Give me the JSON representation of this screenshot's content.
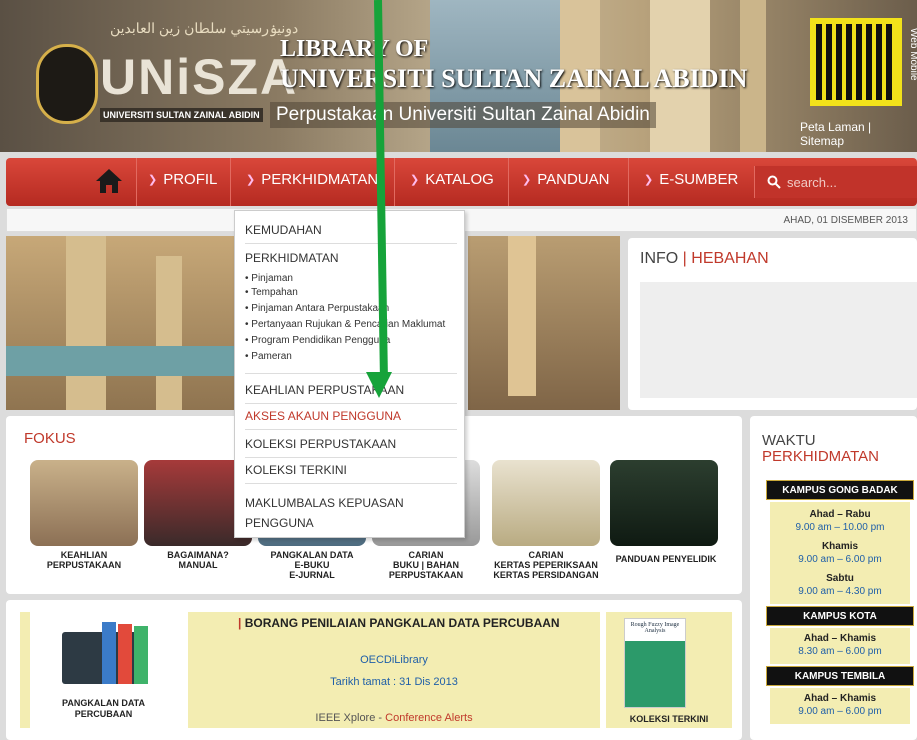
{
  "header": {
    "logo_text": "UNiSZA",
    "logo_arabic": "دونيۏرسيتي سلطان زين العابدين",
    "logo_sub": "UNIVERSITI SULTAN ZAINAL ABIDIN",
    "library_line1": "LIBRARY OF",
    "library_line2": "UNIVERSITI SULTAN ZAINAL ABIDIN",
    "library_line3": "Perpustakaan Universiti Sultan Zainal Abidin",
    "web_mobile": "Web Mobile",
    "peta_laman": "Peta Laman",
    "sitemap": "Sitemap"
  },
  "nav": {
    "items": [
      {
        "label": "PROFIL"
      },
      {
        "label": "PERKHIDMATAN"
      },
      {
        "label": "KATALOG"
      },
      {
        "label": "PANDUAN"
      },
      {
        "label": "E-SUMBER"
      }
    ],
    "search_placeholder": "search..."
  },
  "date": "AHAD, 01 DISEMBER 2013",
  "dropdown": {
    "kemudahan": "KEMUDAHAN",
    "perkhidmatan": "PERKHIDMATAN",
    "sub": [
      "Pinjaman",
      "Tempahan",
      "Pinjaman Antara Perpustakaan",
      "Pertanyaan Rujukan & Pencarian Maklumat",
      "Program Pendidikan Pengguna",
      "Pameran"
    ],
    "keahlian": "KEAHLIAN PERPUSTAKAAN",
    "akses": "AKSES AKAUN PENGGUNA",
    "koleksi_perpustakaan": "KOLEKSI PERPUSTAKAAN",
    "koleksi_terkini": "KOLEKSI TERKINI",
    "maklumbalas_1": "MAKLUMBALAS KEPUASAN",
    "maklumbalas_2": "PENGGUNA"
  },
  "info": {
    "title_a": "INFO",
    "sep": "|",
    "title_b": "HEBAHAN"
  },
  "fokus": {
    "title": "FOKUS",
    "items": [
      {
        "label": "KEAHLIAN\nPERPUSTAKAAN"
      },
      {
        "label": "BAGAIMANA?\nMANUAL"
      },
      {
        "label": "PANGKALAN DATA\nE-BUKU\nE-JURNAL"
      },
      {
        "label": "CARIAN\nBUKU | BAHAN\nPERPUSTAKAAN"
      },
      {
        "label": "CARIAN\nKERTAS PEPERIKSAAN\nKERTAS PERSIDANGAN"
      },
      {
        "label": "PANDUAN PENYELIDIK"
      }
    ]
  },
  "waktu": {
    "title_1": "WAKTU",
    "title_2": "PERKHIDMATAN",
    "kampus_gong_badak": "KAMPUS GONG BADAK",
    "gb": [
      {
        "day": "Ahad – Rabu",
        "hours": "9.00 am – 10.00 pm"
      },
      {
        "day": "Khamis",
        "hours": "9.00 am – 6.00 pm"
      },
      {
        "day": "Sabtu",
        "hours": "9.00 am – 4.30 pm"
      }
    ],
    "kampus_kota": "KAMPUS KOTA",
    "kota": {
      "day": "Ahad – Khamis",
      "hours": "8.30 am – 6.00 pm"
    },
    "kampus_tembila": "KAMPUS TEMBILA",
    "tembila": {
      "day": "Ahad – Khamis",
      "hours": "9.00 am – 6.00 pm"
    }
  },
  "bottom": {
    "pangkalan_label": "PANGKALAN DATA\nPERCUBAAN",
    "borang_sep": "|",
    "borang_title": "BORANG PENILAIAN PANGKALAN DATA PERCUBAAN",
    "oecd": "OECDiLibrary",
    "tarikh": "Tarikh tamat : 31 Dis 2013",
    "ieee": "IEEE Xplore",
    "ieee_sep": "-",
    "conference": "Conference Alerts",
    "book_title": "Rough Fuzzy Image Analysis",
    "koleksi_terkini": "KOLEKSI TERKINI"
  },
  "colors": {
    "accent": "#c0392b",
    "nav": "#c9362c",
    "arrow": "#16a33a"
  }
}
